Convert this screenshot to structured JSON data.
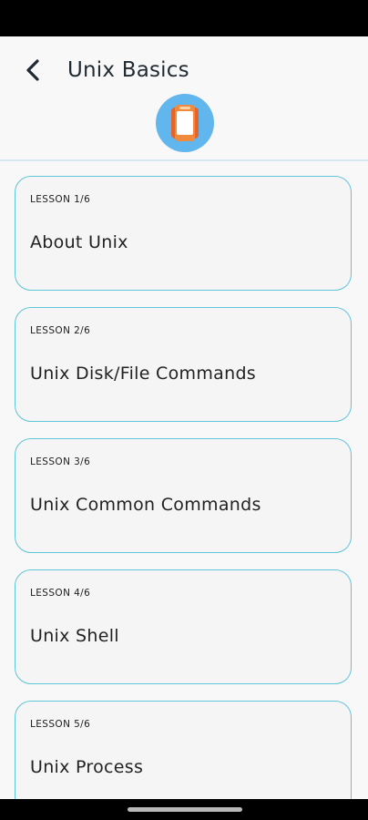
{
  "header": {
    "title": "Unix Basics",
    "back_icon": "arrow-back-icon",
    "app_icon": "app-logo-icon",
    "app_icon_color": "#62b6ee"
  },
  "lessons": [
    {
      "number": "LESSON 1/6",
      "title": "About Unix"
    },
    {
      "number": "LESSON 2/6",
      "title": "Unix Disk/File Commands"
    },
    {
      "number": "LESSON 3/6",
      "title": "Unix Common Commands"
    },
    {
      "number": "LESSON 4/6",
      "title": "Unix Shell"
    },
    {
      "number": "LESSON 5/6",
      "title": "Unix Process"
    }
  ],
  "colors": {
    "card_border": "#5ec4d6",
    "background": "#f8f8f8"
  }
}
